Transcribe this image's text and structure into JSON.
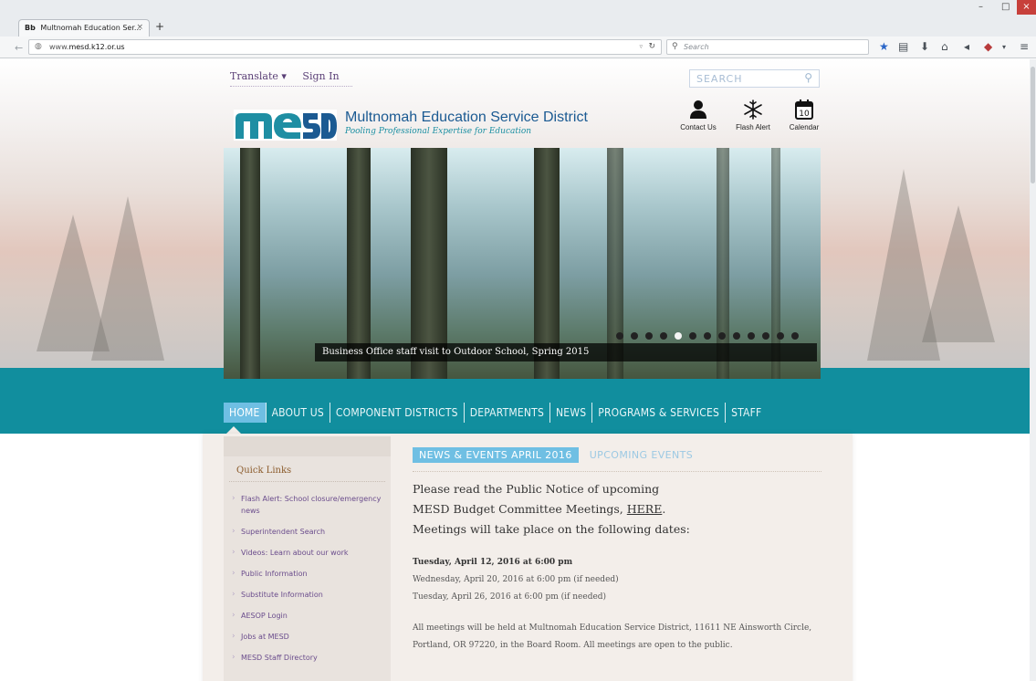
{
  "browser": {
    "tab_title": "Multnomah Education Ser...",
    "tab_favicon": "Bb",
    "tab_close": "×",
    "new_tab": "+",
    "url_prefix": "www.",
    "url_domain": "mesd.k12.or.us",
    "search_placeholder": "Search",
    "window_min": "–",
    "window_max": "□",
    "window_close": "×"
  },
  "header": {
    "translate_label": "Translate ▾",
    "signin_label": "Sign In",
    "search_placeholder": "SEARCH",
    "logo_title": "Multnomah Education Service District",
    "logo_tagline": "Pooling Professional Expertise for Education",
    "quick_icons": [
      {
        "label": "Contact Us",
        "icon": "contact-icon"
      },
      {
        "label": "Flash Alert",
        "icon": "snowflake-icon"
      },
      {
        "label": "Calendar",
        "icon": "calendar-icon",
        "day": "10"
      }
    ]
  },
  "hero": {
    "caption": "Business Office staff visit to Outdoor School, Spring 2015",
    "slide_count": 13,
    "active_slide": 4
  },
  "menu": {
    "items": [
      "HOME",
      "ABOUT US",
      "COMPONENT DISTRICTS",
      "DEPARTMENTS",
      "NEWS",
      "PROGRAMS & SERVICES",
      "STAFF"
    ],
    "active_index": 0
  },
  "sidebar": {
    "title": "Quick Links",
    "links": [
      "Flash Alert: School closure/emergency news",
      "Superintendent Search",
      "Videos: Learn about our work",
      "Public Information",
      "Substitute Information",
      "AESOP Login",
      "Jobs at MESD",
      "MESD Staff Directory"
    ]
  },
  "main": {
    "tab_active": "NEWS & EVENTS APRIL 2016",
    "tab_other": "UPCOMING EVENTS",
    "notice_line1": "Please read the Public Notice of upcoming",
    "notice_line2_pre": "MESD Budget Committee Meetings, ",
    "notice_link": "HERE",
    "notice_line2_post": ".",
    "notice_line3": "Meetings will take place on the following dates:",
    "date1": "Tuesday, April 12, 2016 at 6:00 pm",
    "date2": "Wednesday, April 20, 2016 at 6:00 pm (if needed)",
    "date3": "Tuesday, April 26, 2016 at 6:00 pm (if needed)",
    "location_note": "All meetings will be held at Multnomah Education Service District, 11611 NE Ainsworth Circle, Portland, OR 97220, in the Board Room. All meetings are open to the public."
  },
  "colors": {
    "teal": "#118e9e",
    "logo_blue": "#1b5a92",
    "menu_active": "#6fbfe3",
    "link_purple": "#6a4c8c"
  }
}
